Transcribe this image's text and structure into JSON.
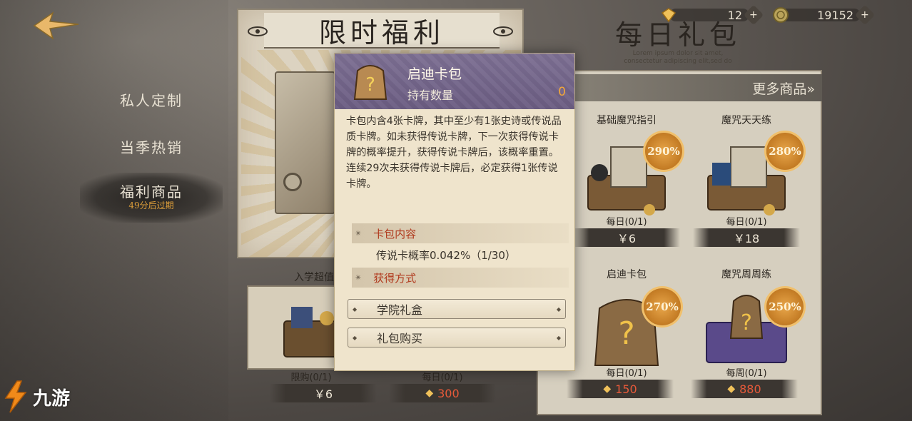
{
  "sidebar": {
    "items": [
      {
        "label": "私人定制"
      },
      {
        "label": "当季热销"
      },
      {
        "label": "福利商品",
        "sub": "49分后过期"
      }
    ]
  },
  "header": {
    "gems": "12",
    "coins": "19152"
  },
  "limited_panel": {
    "title": "限时福利",
    "items": [
      {
        "name": "入学超值",
        "limit": "限购(0/1)",
        "price": "￥6"
      },
      {
        "name": "",
        "limit": "每日(0/1)",
        "price": "300",
        "currency": "gem"
      }
    ]
  },
  "daily_panel": {
    "title": "每日礼包",
    "subtitle": "Lorem ipsum dolor sit amet, consectetur adipiscing elit,sed do",
    "more": "更多商品»",
    "cards": [
      {
        "name": "基础魔咒指引",
        "badge": "290%",
        "limit": "每日(0/1)",
        "price": "￥6"
      },
      {
        "name": "魔咒天天练",
        "badge": "280%",
        "limit": "每日(0/1)",
        "price": "￥18"
      },
      {
        "name": "启迪卡包",
        "badge": "270%",
        "limit": "每日(0/1)",
        "price": "150",
        "currency": "gem"
      },
      {
        "name": "魔咒周周练",
        "badge": "250%",
        "limit": "每周(0/1)",
        "price": "880",
        "currency": "gem"
      }
    ]
  },
  "popup": {
    "title": "启迪卡包",
    "count_label": "持有数量",
    "count": "0",
    "description": "卡包内含4张卡牌，其中至少有1张史诗或传说品质卡牌。如未获得传说卡牌，下一次获得传说卡牌的概率提升，获得传说卡牌后，该概率重置。连续29次未获得传说卡牌后，必定获得1张传说卡牌。",
    "section_contents": "卡包内容",
    "rate": "传说卡概率0.042%（1/30）",
    "section_obtain": "获得方式",
    "sources": [
      "学院礼盒",
      "礼包购买"
    ]
  },
  "watermark": {
    "text": "九游"
  },
  "colors": {
    "popup_header": "#7d6f93",
    "badge": "#c27a23",
    "gem_price": "#e85a3a",
    "section_text": "#b0371b"
  },
  "icons": [
    "back-arrow-icon",
    "gem-icon",
    "coin-icon",
    "plus-icon",
    "card-pack-icon",
    "star-icon"
  ]
}
